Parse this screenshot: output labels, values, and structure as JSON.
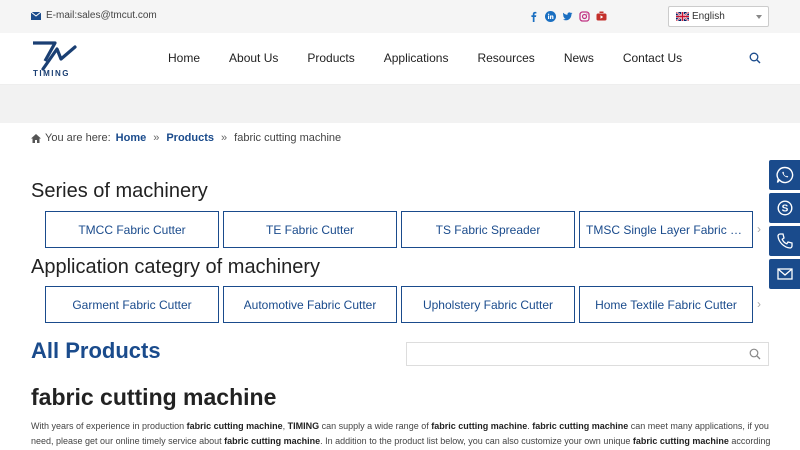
{
  "topbar": {
    "email": "E-mail:sales@tmcut.com",
    "social": [
      "facebook-icon",
      "linkedin-icon",
      "twitter-icon",
      "instagram-icon",
      "youtube-icon"
    ],
    "language": "English"
  },
  "header": {
    "logo_text": "TIMING",
    "nav": [
      "Home",
      "About Us",
      "Products",
      "Applications",
      "Resources",
      "News",
      "Contact Us"
    ]
  },
  "breadcrumb": {
    "prefix": "You are here:",
    "items": [
      "Home",
      "Products",
      "fabric cutting machine"
    ],
    "sep": "»"
  },
  "series": {
    "title": "Series of machinery",
    "items": [
      "TMCC Fabric Cutter",
      "TE Fabric Cutter",
      "TS Fabric Spreader",
      "TMSC Single Layer Fabric Cutter"
    ],
    "arrow": "›"
  },
  "application": {
    "title": "Application categry of machinery",
    "items": [
      "Garment Fabric Cutter",
      "Automotive Fabric Cutter",
      "Upholstery Fabric Cutter",
      "Home Textile Fabric Cutter"
    ],
    "arrow": "›"
  },
  "all_products": {
    "title": "All Products",
    "search_placeholder": ""
  },
  "product": {
    "title": "fabric cutting machine",
    "desc": [
      {
        "t": "With years of experience in production ",
        "b": false
      },
      {
        "t": "fabric cutting machine",
        "b": true
      },
      {
        "t": ", ",
        "b": false
      },
      {
        "t": "TIMING",
        "b": true
      },
      {
        "t": " can supply a wide range of ",
        "b": false
      },
      {
        "t": "fabric cutting machine",
        "b": true
      },
      {
        "t": ". ",
        "b": false
      },
      {
        "t": "fabric cutting machine",
        "b": true
      },
      {
        "t": " can meet many applications, if you need, please get our online timely service about ",
        "b": false
      },
      {
        "t": "fabric cutting machine",
        "b": true
      },
      {
        "t": ". In addition to the product list below, you can also customize your own unique ",
        "b": false
      },
      {
        "t": "fabric cutting machine",
        "b": true
      },
      {
        "t": " according",
        "b": false
      }
    ]
  },
  "float_bar": [
    "whatsapp-icon",
    "skype-icon",
    "phone-icon",
    "mail-icon"
  ],
  "colors": {
    "brand": "#1a4b8c",
    "topbar_bg": "#f5f5f5"
  }
}
